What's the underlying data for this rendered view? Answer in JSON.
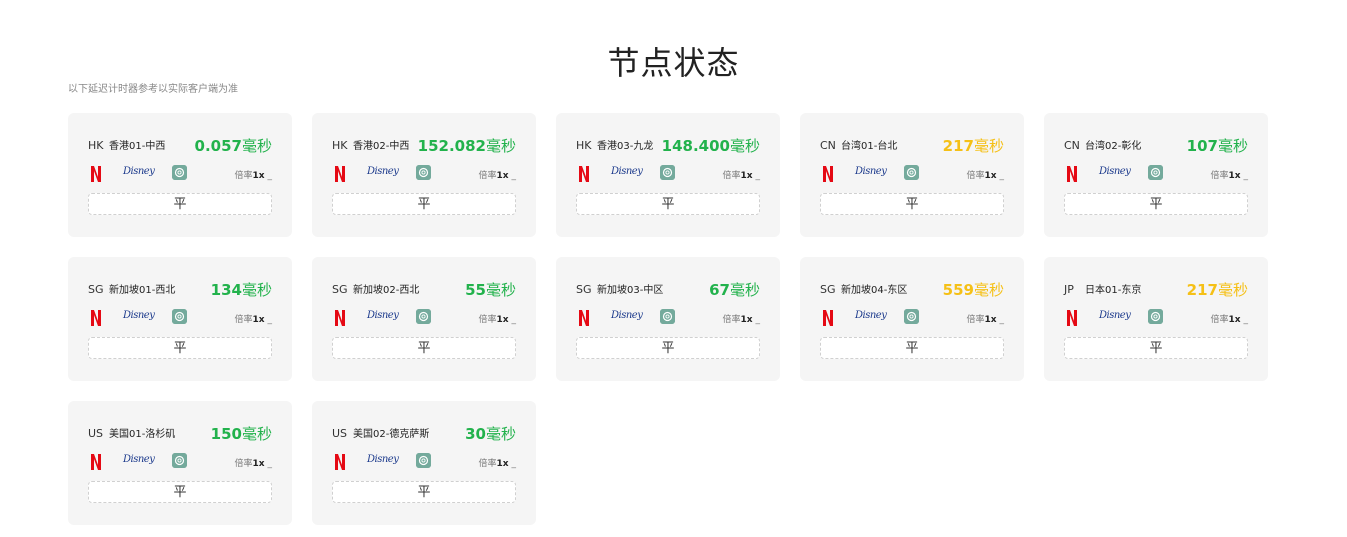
{
  "page": {
    "title": "节点状态",
    "note": "以下延迟计时器参考以实际客户端为准"
  },
  "colors": {
    "good": "#22b24c",
    "warn": "#f5c016",
    "netflix": "#e50914",
    "disney": "#1c3a8c",
    "chatgpt": "#74aa9c"
  },
  "nodes": [
    {
      "cc": "HK",
      "name": "香港01-中西",
      "latency": "0.057",
      "unit": "毫秒",
      "status": "green",
      "rate_label": "倍率",
      "rate": "1x",
      "trend": "平"
    },
    {
      "cc": "HK",
      "name": "香港02-中西",
      "latency": "152.082",
      "unit": "毫秒",
      "status": "green",
      "rate_label": "倍率",
      "rate": "1x",
      "trend": "平"
    },
    {
      "cc": "HK",
      "name": "香港03-九龙",
      "latency": "148.400",
      "unit": "毫秒",
      "status": "green",
      "rate_label": "倍率",
      "rate": "1x",
      "trend": "平"
    },
    {
      "cc": "CN",
      "name": "台湾01-台北",
      "latency": "217",
      "unit": "毫秒",
      "status": "amber",
      "rate_label": "倍率",
      "rate": "1x",
      "trend": "平"
    },
    {
      "cc": "CN",
      "name": "台湾02-彰化",
      "latency": "107",
      "unit": "毫秒",
      "status": "green",
      "rate_label": "倍率",
      "rate": "1x",
      "trend": "平"
    },
    {
      "cc": "SG",
      "name": "新加坡01-西北",
      "latency": "134",
      "unit": "毫秒",
      "status": "green",
      "rate_label": "倍率",
      "rate": "1x",
      "trend": "平"
    },
    {
      "cc": "SG",
      "name": "新加坡02-西北",
      "latency": "55",
      "unit": "毫秒",
      "status": "green",
      "rate_label": "倍率",
      "rate": "1x",
      "trend": "平"
    },
    {
      "cc": "SG",
      "name": "新加坡03-中区",
      "latency": "67",
      "unit": "毫秒",
      "status": "green",
      "rate_label": "倍率",
      "rate": "1x",
      "trend": "平"
    },
    {
      "cc": "SG",
      "name": "新加坡04-东区",
      "latency": "559",
      "unit": "毫秒",
      "status": "amber",
      "rate_label": "倍率",
      "rate": "1x",
      "trend": "平"
    },
    {
      "cc": "JP",
      "name": "日本01-东京",
      "latency": "217",
      "unit": "毫秒",
      "status": "amber",
      "rate_label": "倍率",
      "rate": "1x",
      "trend": "平"
    },
    {
      "cc": "US",
      "name": "美国01-洛杉矶",
      "latency": "150",
      "unit": "毫秒",
      "status": "green",
      "rate_label": "倍率",
      "rate": "1x",
      "trend": "平"
    },
    {
      "cc": "US",
      "name": "美国02-德克萨斯",
      "latency": "30",
      "unit": "毫秒",
      "status": "green",
      "rate_label": "倍率",
      "rate": "1x",
      "trend": "平"
    }
  ],
  "service_icons": [
    "netflix-icon",
    "disney-plus-icon",
    "chatgpt-icon"
  ],
  "disney_text": "Disney"
}
